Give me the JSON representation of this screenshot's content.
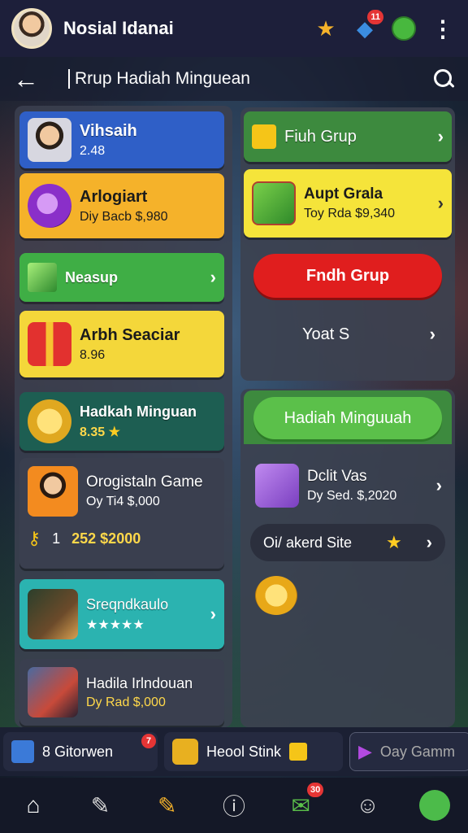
{
  "topbar": {
    "title": "Nosial Idanai",
    "icons": [
      "avatar",
      "star-icon",
      "shield-icon",
      "clover-icon",
      "more-icon"
    ],
    "badges": {
      "shield": "11"
    }
  },
  "subheader": {
    "title": "Rrup Hadiah Minguean"
  },
  "left": [
    {
      "title": "Vihsaih",
      "sub": "2.48",
      "color": "#2f5fc7",
      "icon": "profile-thumb"
    },
    {
      "title": "Arlogiart",
      "sub": "Diy  Bacb $,980",
      "color": "#f5b22a",
      "icon": "potion-icon"
    },
    {
      "title": "Neasup",
      "sub": "",
      "color": "#3fae45",
      "icon": "gem-icon"
    },
    {
      "title": "Arbh Seaciar",
      "sub": "8.96",
      "color": "#f4d73a",
      "icon": "gift-icon"
    },
    {
      "title": "Hadkah Minguan",
      "sub": "8.35",
      "color": "#1d5e52",
      "icon": "coin-icon"
    },
    {
      "title": "Orogistaln Game",
      "sub": "Oy   Ti4  $,000",
      "extra": "252  $2000",
      "extra_pre": "1",
      "color": "#3a3f4f",
      "icon": "player-thumb"
    },
    {
      "title": "Sreqndkaulo",
      "sub": "★★★★★",
      "color": "#2bb3b0",
      "icon": "hero-thumb"
    },
    {
      "title": "Hadila Irlndouan",
      "sub": "Dy   Rad $,000",
      "color": "#3a3f4f",
      "icon": "warrior-thumb"
    }
  ],
  "right": {
    "fish_grup": "Fiuh Grup",
    "apt": {
      "title": "Aupt Grala",
      "sub": "Toy  Rda  $9,340"
    },
    "red_btn": "Fndh Grup",
    "yoat": "Yoat S",
    "green_btn": "Hadiah Minguuah",
    "dclit": {
      "title": "Dclit Vas",
      "sub": "Dy   Sed. $,2020"
    },
    "site": "Oi/ akerd Site"
  },
  "tabs": [
    {
      "label": "8 Gitorwen",
      "badge": "7"
    },
    {
      "label": "Heool Stink",
      "badge": ""
    },
    {
      "label": "Oay Gamm",
      "badge": ""
    }
  ],
  "nav": {
    "badge": "30"
  },
  "colors": {
    "accent_yellow": "#f5c518",
    "red": "#e02020",
    "green": "#3fae45"
  }
}
